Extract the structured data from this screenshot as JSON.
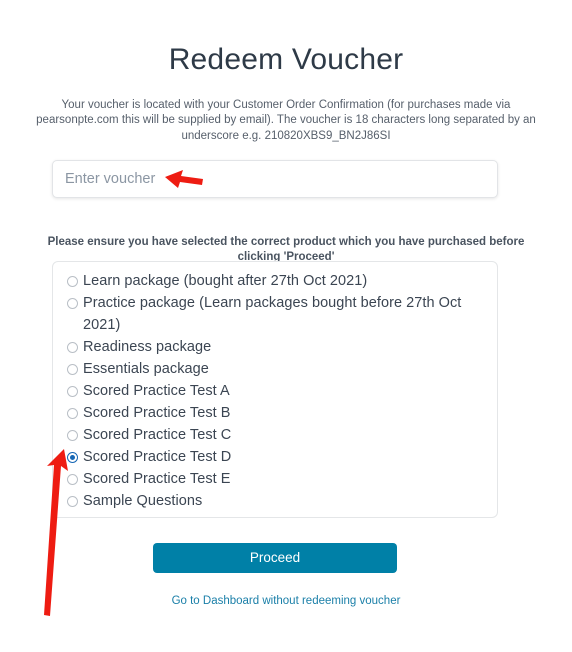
{
  "page": {
    "title": "Redeem Voucher",
    "intro_text": "Your voucher is located with your Customer Order Confirmation (for purchases made via pearsonpte.com this will be supplied by email). The voucher is 18 characters long separated by an underscore e.g. 210820XBS9_BN2J86SI",
    "ensure_text": "Please ensure you have selected the correct product which you have purchased before clicking 'Proceed'"
  },
  "voucher_field": {
    "value": "",
    "placeholder": "Enter voucher"
  },
  "options": {
    "selected": "Scored Practice Test D",
    "items": [
      {
        "label": "Learn package (bought after 27th Oct 2021)",
        "selected": false
      },
      {
        "label": "Practice package (Learn packages bought before 27th Oct 2021)",
        "selected": false
      },
      {
        "label": "Readiness package",
        "selected": false
      },
      {
        "label": "Essentials package",
        "selected": false
      },
      {
        "label": "Scored Practice Test A",
        "selected": false
      },
      {
        "label": "Scored Practice Test B",
        "selected": false
      },
      {
        "label": "Scored Practice Test C",
        "selected": false
      },
      {
        "label": "Scored Practice Test D",
        "selected": true
      },
      {
        "label": "Scored Practice Test E",
        "selected": false
      },
      {
        "label": "Sample Questions",
        "selected": false
      }
    ]
  },
  "actions": {
    "proceed_label": "Proceed",
    "dashboard_link_label": "Go to Dashboard without redeeming voucher"
  },
  "annotations": [
    {
      "name": "arrow-pointing-to-voucher-input",
      "direction": "left",
      "color": "#ee1c12"
    },
    {
      "name": "arrow-pointing-to-selected-option",
      "direction": "up-right",
      "color": "#ee1c12"
    }
  ],
  "colors": {
    "title": "#2e3a47",
    "primary_button": "#0080a7",
    "link": "#1a7fa8",
    "radio_selected": "#1767b5",
    "annotation_red": "#ee1c12",
    "body_text": "#3a4550"
  }
}
